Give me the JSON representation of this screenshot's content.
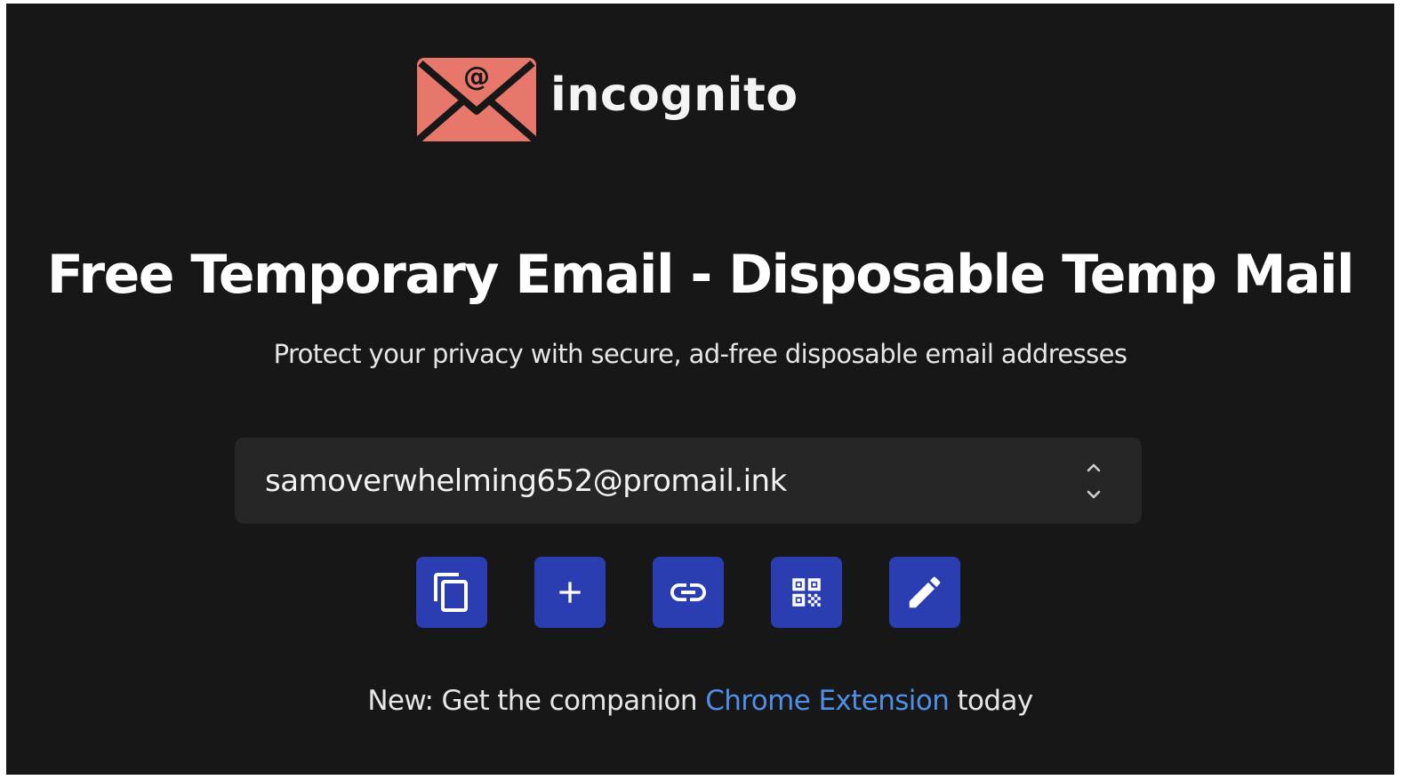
{
  "brand": {
    "name": "incognito",
    "logo_icon": "envelope-at-icon",
    "logo_color": "#e8776b"
  },
  "hero": {
    "title": "Free Temporary Email - Disposable Temp Mail",
    "subtitle": "Protect your privacy with secure, ad-free disposable email addresses"
  },
  "email_selector": {
    "selected_value": "samoverwhelming652@promail.ink",
    "arrow_icon": "chevron-up-down-icon"
  },
  "actions": [
    {
      "name": "copy",
      "icon": "copy-icon"
    },
    {
      "name": "new",
      "icon": "plus-icon"
    },
    {
      "name": "link",
      "icon": "link-icon"
    },
    {
      "name": "qr",
      "icon": "qr-code-icon"
    },
    {
      "name": "edit",
      "icon": "pencil-icon"
    }
  ],
  "promo": {
    "prefix": "New: Get the companion ",
    "link_text": "Chrome Extension",
    "suffix": " today"
  },
  "colors": {
    "background": "#171717",
    "button": "#2a3eb1",
    "link": "#4f8fe8",
    "select_bg": "#262626"
  }
}
